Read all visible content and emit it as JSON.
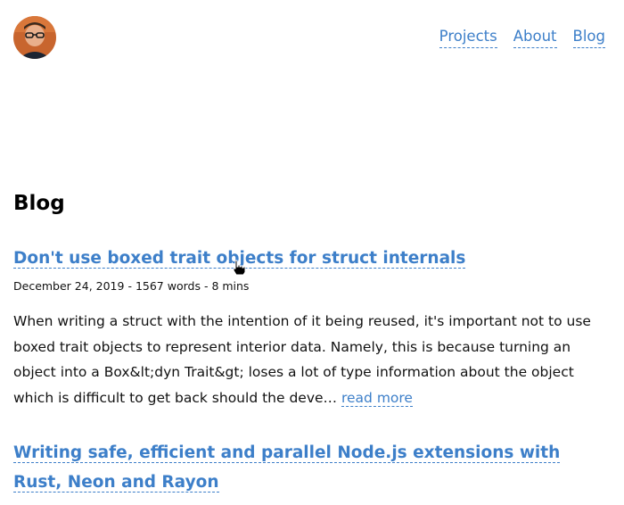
{
  "header": {
    "avatar_alt": "profile photo",
    "nav": [
      {
        "label": "Projects"
      },
      {
        "label": "About"
      },
      {
        "label": "Blog"
      }
    ]
  },
  "main": {
    "title": "Blog",
    "posts": [
      {
        "title": "Don't use boxed trait objects for struct internals",
        "date": "December 24, 2019",
        "words": "1567 words",
        "read_time": "8 mins",
        "excerpt": "When writing a struct with the intention of it being reused, it's important not to use boxed trait objects to represent interior data. Namely, this is because turning an object into a Box&lt;dyn Trait&gt; loses a lot of type information about the object which is difficult to get back should the deve…",
        "read_more": "read more"
      },
      {
        "title": "Writing safe, efficient and parallel Node.js extensions with Rust, Neon and Rayon"
      }
    ]
  },
  "colors": {
    "link": "#3d7fc9",
    "text": "#111111",
    "background": "#ffffff"
  }
}
